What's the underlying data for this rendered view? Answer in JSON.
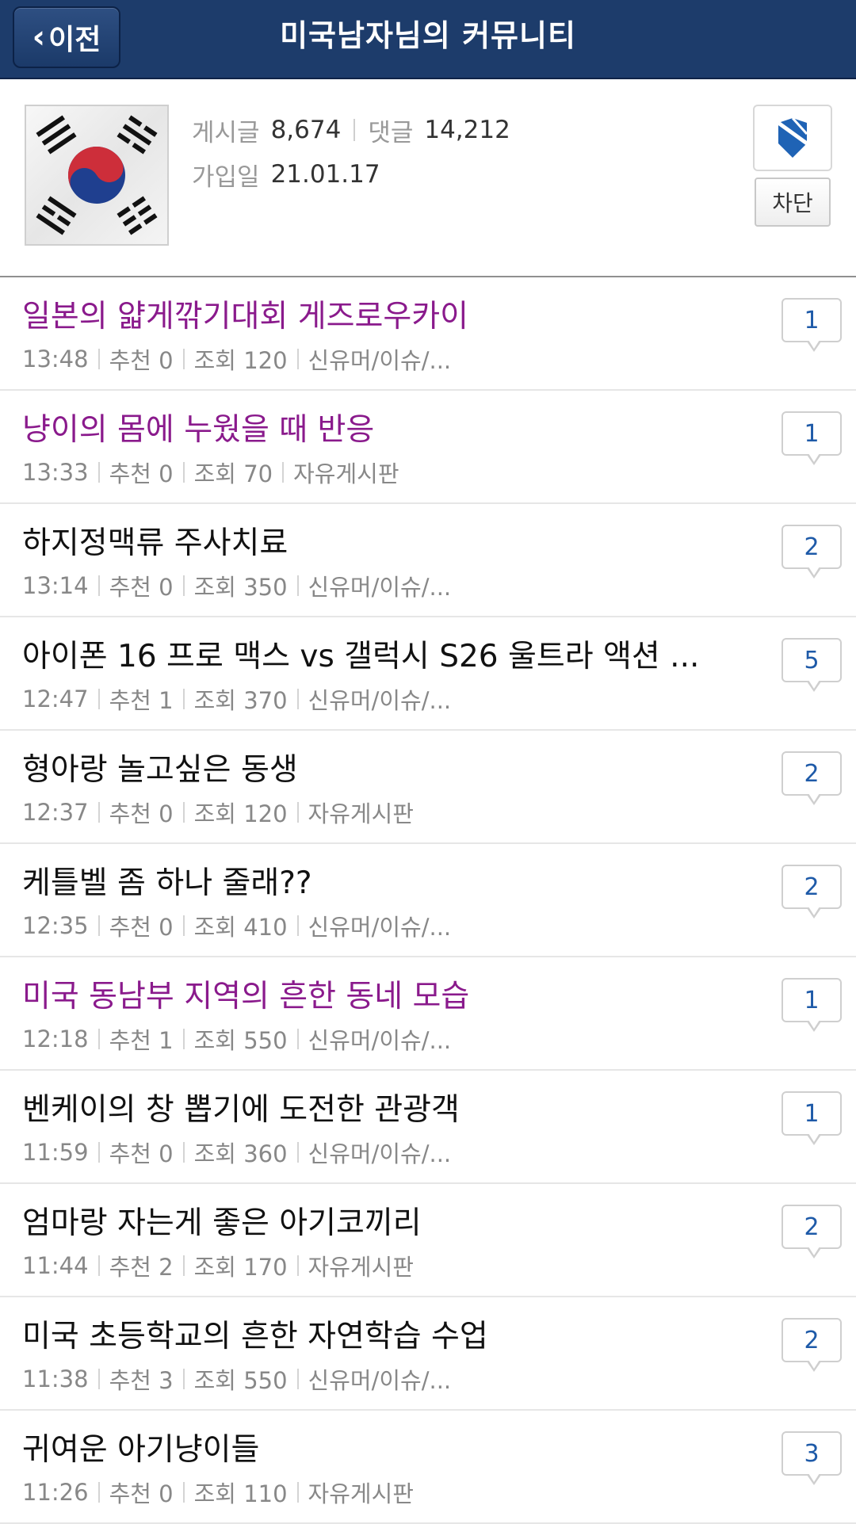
{
  "header": {
    "back_label": "이전",
    "title": "미국남자님의 커뮤니티"
  },
  "profile": {
    "posts_label": "게시글",
    "posts_value": "8,674",
    "comments_label": "댓글",
    "comments_value": "14,212",
    "joined_label": "가입일",
    "joined_value": "21.01.17",
    "block_label": "차단",
    "bookmark_icon": "bookmark-icon"
  },
  "posts": [
    {
      "title": "일본의 얇게깎기대회 게즈로우카이",
      "time": "13:48",
      "rec": "추천 0",
      "views": "조회 120",
      "board": "신유머/이슈/...",
      "comments": "1",
      "visited": true
    },
    {
      "title": "냥이의 몸에 누웠을 때 반응",
      "time": "13:33",
      "rec": "추천 0",
      "views": "조회 70",
      "board": "자유게시판",
      "comments": "1",
      "visited": true
    },
    {
      "title": "하지정맥류 주사치료",
      "time": "13:14",
      "rec": "추천 0",
      "views": "조회 350",
      "board": "신유머/이슈/...",
      "comments": "2",
      "visited": false
    },
    {
      "title": "아이폰 16 프로 맥스 vs 갤럭시 S26 울트라 액션 ...",
      "time": "12:47",
      "rec": "추천 1",
      "views": "조회 370",
      "board": "신유머/이슈/...",
      "comments": "5",
      "visited": false
    },
    {
      "title": "형아랑 놀고싶은 동생",
      "time": "12:37",
      "rec": "추천 0",
      "views": "조회 120",
      "board": "자유게시판",
      "comments": "2",
      "visited": false
    },
    {
      "title": "케틀벨 좀 하나 줄래??",
      "time": "12:35",
      "rec": "추천 0",
      "views": "조회 410",
      "board": "신유머/이슈/...",
      "comments": "2",
      "visited": false
    },
    {
      "title": "미국 동남부 지역의 흔한 동네 모습",
      "time": "12:18",
      "rec": "추천 1",
      "views": "조회 550",
      "board": "신유머/이슈/...",
      "comments": "1",
      "visited": true
    },
    {
      "title": "벤케이의 창 뽑기에 도전한 관광객",
      "time": "11:59",
      "rec": "추천 0",
      "views": "조회 360",
      "board": "신유머/이슈/...",
      "comments": "1",
      "visited": false
    },
    {
      "title": "엄마랑 자는게 좋은 아기코끼리",
      "time": "11:44",
      "rec": "추천 2",
      "views": "조회 170",
      "board": "자유게시판",
      "comments": "2",
      "visited": false
    },
    {
      "title": "미국 초등학교의 흔한 자연학습 수업",
      "time": "11:38",
      "rec": "추천 3",
      "views": "조회 550",
      "board": "신유머/이슈/...",
      "comments": "2",
      "visited": false
    },
    {
      "title": "귀여운 아기냥이들",
      "time": "11:26",
      "rec": "추천 0",
      "views": "조회 110",
      "board": "자유게시판",
      "comments": "3",
      "visited": false
    }
  ],
  "colors": {
    "header_bg": "#1d3c6b",
    "visited_title": "#8a1a8c",
    "comment_count": "#1e5aa8"
  }
}
